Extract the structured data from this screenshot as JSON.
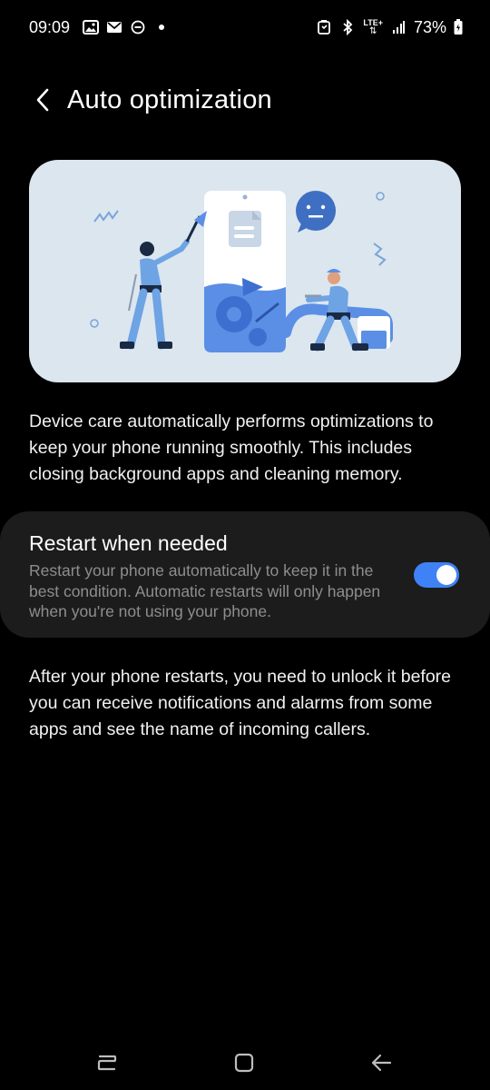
{
  "status_bar": {
    "time": "09:09",
    "battery_percent": "73%",
    "network_label": "LTE+",
    "left_icons": [
      "gallery-icon",
      "mail-icon",
      "dnd-icon",
      "dot-icon"
    ],
    "right_icons": [
      "alarm-icon",
      "bluetooth-icon",
      "lte-icon",
      "signal-icon",
      "battery-icon"
    ]
  },
  "header": {
    "title": "Auto optimization",
    "back_icon": "back-chevron-icon"
  },
  "description": "Device care automatically performs optimizations to keep your phone running smoothly. This includes closing background apps and cleaning memory.",
  "restart_setting": {
    "title": "Restart when needed",
    "subtitle": "Restart your phone automatically to keep it in the best condition. Automatic restarts will only happen when you're not using your phone.",
    "enabled": true
  },
  "note": "After your phone restarts, you need to unlock it before you can receive notifications and alarms from some apps and see the name of incoming callers.",
  "nav_bar": {
    "buttons": [
      "recents-icon",
      "home-icon",
      "back-icon"
    ]
  },
  "colors": {
    "accent": "#3e82f6",
    "card_bg": "#1c1c1c",
    "illustration_bg": "#dbe6ef"
  }
}
